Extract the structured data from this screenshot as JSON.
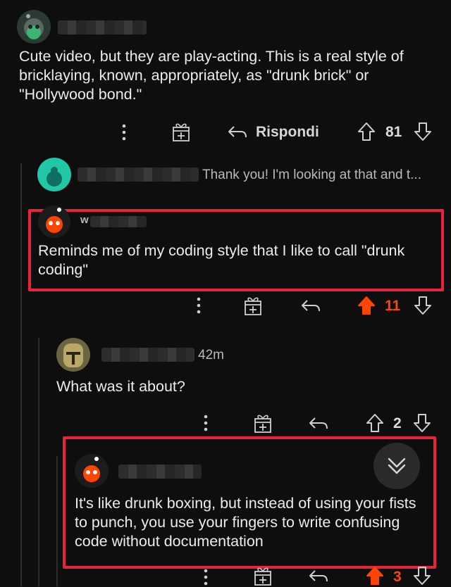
{
  "comments": [
    {
      "text": "Cute video, but they are play-acting.  This is a real style of bricklaying, known, appropriately, as \"drunk brick\" or \"Hollywood bond.\"",
      "reply_label": "Rispondi",
      "votes": "81"
    },
    {
      "collapsed_preview": "Thank you! I'm looking at that and t..."
    },
    {
      "author_fragment": "w",
      "text": "Reminds me of my coding style that I like to call \"drunk coding\"",
      "votes": "11",
      "upvoted": true
    },
    {
      "time": "42m",
      "text": "What was it about?",
      "votes": "2"
    },
    {
      "text": "It's like drunk boxing, but instead of using your fists to punch, you use your fingers to write confusing code without documentation",
      "votes": "3",
      "upvoted": true
    }
  ],
  "colors": {
    "upvote_active": "#ff4500",
    "highlight": "#e8243b",
    "background": "#0e0e0e"
  },
  "icons": [
    "more-icon",
    "award-gift-icon",
    "reply-arrow-icon",
    "upvote-arrow-icon",
    "downvote-arrow-icon",
    "chevron-double-down-icon",
    "snoo-avatar"
  ]
}
